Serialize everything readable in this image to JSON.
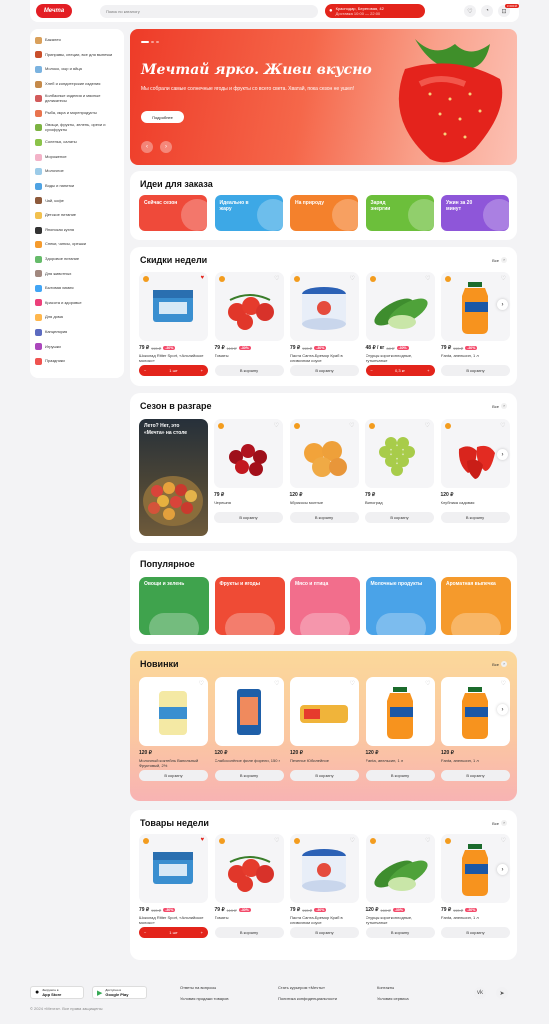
{
  "header": {
    "logo": "Мечта",
    "search_placeholder": "Поиск по каталогу",
    "address_line1": "Краснодар, Береговая, 42",
    "address_line2": "Доставка 10:00 — 22:00",
    "cart_badge": "3 000 ₽"
  },
  "sidebar": {
    "items": [
      {
        "label": "Бакалея",
        "color": "#d9a05b"
      },
      {
        "label": "Приправы, специи, все для выпечки",
        "color": "#c94f2b"
      },
      {
        "label": "Молоко, сыр и яйца",
        "color": "#7bb3e0"
      },
      {
        "label": "Хлеб и кондитерские изделия",
        "color": "#c58a4a"
      },
      {
        "label": "Колбасные изделия и мясные деликатесы",
        "color": "#d25b5b"
      },
      {
        "label": "Рыба, икра и морепродукты",
        "color": "#e9744e"
      },
      {
        "label": "Овощи, фрукты, зелень, орехи и сухофрукты",
        "color": "#7cb342"
      },
      {
        "label": "Соленья, салаты",
        "color": "#8bc34a"
      },
      {
        "label": "Мороженое",
        "color": "#f3b3c8"
      },
      {
        "label": "Молочное",
        "color": "#9ccbe8"
      },
      {
        "label": "Воды и напитки",
        "color": "#4fa3e3"
      },
      {
        "label": "Чай, кофе",
        "color": "#8d5a3b"
      },
      {
        "label": "Детское питание",
        "color": "#f2c14e"
      },
      {
        "label": "Японская кухня",
        "color": "#333333"
      },
      {
        "label": "Снеки, чипсы, орешки",
        "color": "#f59b2d"
      },
      {
        "label": "Здоровое питание",
        "color": "#66bb6a"
      },
      {
        "label": "Для животных",
        "color": "#a1887f"
      },
      {
        "label": "Бытовая химия",
        "color": "#42a5f5"
      },
      {
        "label": "Красота и здоровье",
        "color": "#ec407a"
      },
      {
        "label": "Для дома",
        "color": "#ffb74d"
      },
      {
        "label": "Канцелярия",
        "color": "#5c6bc0"
      },
      {
        "label": "Игрушки",
        "color": "#ab47bc"
      },
      {
        "label": "Праздники",
        "color": "#ef5350"
      }
    ]
  },
  "hero": {
    "title": "Мечтай ярко. Живи вкусно",
    "text": "Мы собрали самые солнечные ягоды и фрукты со всего света. Хватай, пока сезон не ушел!",
    "button": "Подробнее"
  },
  "ideas": {
    "title": "Идеи для заказа",
    "items": [
      {
        "label": "Сейчас сезон",
        "color": "#ef4a3a"
      },
      {
        "label": "Идеально в жару",
        "color": "#3da8e6"
      },
      {
        "label": "На природу",
        "color": "#f4812c"
      },
      {
        "label": "Заряд энергии",
        "color": "#6cbf3b"
      },
      {
        "label": "Ужин за 20 минут",
        "color": "#8e56d9"
      }
    ]
  },
  "discounts": {
    "title": "Скидки недели",
    "all": "Все",
    "items": [
      {
        "price": "79 ₽",
        "old": "113 ₽",
        "disc": "-30%",
        "name": "Шоколад Ritter Sport, «Альпийское молоко»",
        "btn": "1 шт",
        "inCart": true,
        "fav": true
      },
      {
        "price": "79 ₽",
        "old": "113 ₽",
        "disc": "-30%",
        "name": "Томаты",
        "btn": "В корзину",
        "inCart": false,
        "fav": false
      },
      {
        "price": "79 ₽",
        "old": "113 ₽",
        "disc": "-30%",
        "name": "Паста Санта-Бремор Краб в сливочном соусе",
        "btn": "В корзину",
        "inCart": false,
        "fav": false
      },
      {
        "price": "48 ₽ / кг",
        "old": "68 ₽",
        "disc": "-30%",
        "name": "Огурцы короткоплодные, тутынчатые",
        "btn": "0,3 кг",
        "inCart": true,
        "fav": false
      },
      {
        "price": "79 ₽",
        "old": "113 ₽",
        "disc": "-30%",
        "name": "Fanta, апельсин, 1 л",
        "btn": "В корзину",
        "inCart": false,
        "fav": false
      }
    ]
  },
  "season": {
    "title": "Сезон в разгаре",
    "all": "Все",
    "banner": "Лето? Нет, это «Мечта» на столе",
    "items": [
      {
        "price": "79 ₽",
        "name": "Черешня",
        "btn": "В корзину"
      },
      {
        "price": "120 ₽",
        "name": "Абрикосы молтые",
        "btn": "В корзину"
      },
      {
        "price": "79 ₽",
        "name": "Виноград",
        "btn": "В корзину"
      },
      {
        "price": "120 ₽",
        "name": "Клубника садовая",
        "btn": "В корзину"
      }
    ]
  },
  "popular": {
    "title": "Популярное",
    "items": [
      {
        "label": "Овощи и зелень",
        "color": "#3fa34d"
      },
      {
        "label": "Фрукты и ягоды",
        "color": "#ef4b35"
      },
      {
        "label": "Мясо и птица",
        "color": "#f26e8c"
      },
      {
        "label": "Молочные продукты",
        "color": "#4aa3e8"
      },
      {
        "label": "Ароматная выпечка",
        "color": "#f59a2c"
      }
    ]
  },
  "novelties": {
    "title": "Новинки",
    "all": "Все",
    "items": [
      {
        "price": "120 ₽",
        "name": "Молочный коктейль Ванильный Фруктовый, 2%",
        "btn": "В корзину"
      },
      {
        "price": "120 ₽",
        "name": "Слабосолёное филе форели, 150 г",
        "btn": "В корзину"
      },
      {
        "price": "120 ₽",
        "name": "Печенье Юбилейное",
        "btn": "В корзину"
      },
      {
        "price": "120 ₽",
        "name": "Fanta, апельсин, 1 л",
        "btn": "В корзину"
      },
      {
        "price": "120 ₽",
        "name": "Fanta, апельсин, 1 л",
        "btn": "В корзину"
      }
    ]
  },
  "week": {
    "title": "Товары недели",
    "all": "Все",
    "items": [
      {
        "price": "79 ₽",
        "old": "113 ₽",
        "disc": "-30%",
        "name": "Шоколад Ritter Sport, «Альпийское молоко»",
        "btn": "1 шт",
        "inCart": true,
        "fav": true
      },
      {
        "price": "79 ₽",
        "old": "113 ₽",
        "disc": "-30%",
        "name": "Томаты",
        "btn": "В корзину",
        "inCart": false,
        "fav": false
      },
      {
        "price": "79 ₽",
        "old": "113 ₽",
        "disc": "-30%",
        "name": "Паста Санта-Бремор Краб в сливочном соусе",
        "btn": "В корзину",
        "inCart": false,
        "fav": false
      },
      {
        "price": "120 ₽",
        "old": "160 ₽",
        "disc": "-30%",
        "name": "Огурцы короткоплодные, тутынчатые",
        "btn": "В корзину",
        "inCart": false,
        "fav": false
      },
      {
        "price": "79 ₽",
        "old": "113 ₽",
        "disc": "-30%",
        "name": "Fanta, апельсин, 1 л",
        "btn": "В корзину",
        "inCart": false,
        "fav": false
      }
    ]
  },
  "footer": {
    "appstore_top": "Загрузите в",
    "appstore": "App Store",
    "gplay_top": "Доступно в",
    "gplay": "Google Play",
    "links": [
      "Ответы на вопросы",
      "Стать курьером «Мечты»",
      "Контакты",
      "Условия продажи товаров",
      "Политика конфиденциальности",
      "Условия сервиса"
    ],
    "copyright": "© 2024 «Мечта». Все права защищены"
  }
}
